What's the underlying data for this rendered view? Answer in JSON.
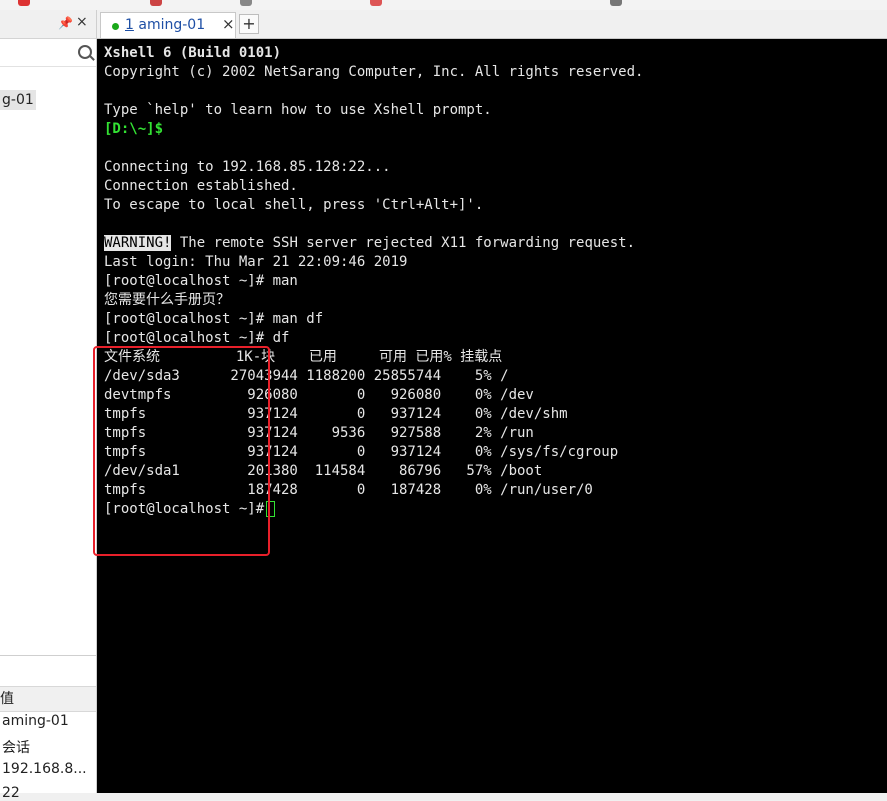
{
  "tab": {
    "number": "1",
    "title": "aming-01",
    "close": "×",
    "add": "+"
  },
  "left_panel": {
    "pin": "ᵮ",
    "close": "×",
    "tree_item": "g-01",
    "prop_header": "值",
    "props": [
      "aming-01",
      "会话",
      "192.168.8...",
      "22"
    ]
  },
  "terminal": {
    "lines": [
      "Xshell 6 (Build 0101)",
      "Copyright (c) 2002 NetSarang Computer, Inc. All rights reserved.",
      "",
      "Type `help' to learn how to use Xshell prompt.",
      "[D:\\~]$",
      "",
      "Connecting to 192.168.85.128:22...",
      "Connection established.",
      "To escape to local shell, press 'Ctrl+Alt+]'.",
      "",
      "WARNING!",
      "Last login: Thu Mar 21 22:09:46 2019",
      "[root@localhost ~]# man",
      "您需要什么手册页？",
      "[root@localhost ~]# man df",
      "[root@localhost ~]# df",
      "文件系统         1K-块    已用     可用 已用% 挂载点",
      "/dev/sda3      27043944 1188200 25855744    5% /",
      "devtmpfs         926080       0   926080    0% /dev",
      "tmpfs            937124       0   937124    0% /dev/shm",
      "tmpfs            937124    9536   927588    2% /run",
      "tmpfs            937124       0   937124    0% /sys/fs/cgroup",
      "/dev/sda1        201380  114584    86796   57% /boot",
      "tmpfs            187428       0   187428    0% /run/user/0",
      "[root@localhost ~]#"
    ],
    "warning_rest": " The remote SSH server rejected X11 forwarding request."
  },
  "colors": {
    "prompt_green": "#33e233",
    "highlight_red": "#e8202a",
    "tab_text": "#1e4fa5"
  }
}
